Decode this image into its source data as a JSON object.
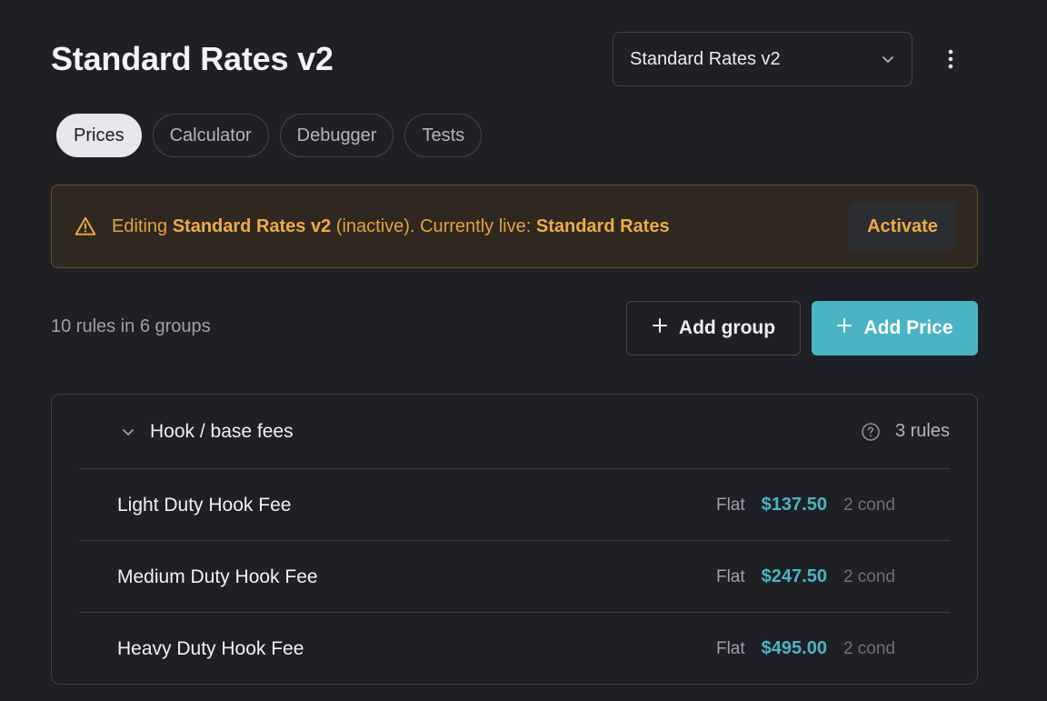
{
  "header": {
    "title": "Standard Rates v2",
    "version_select": {
      "value": "Standard Rates v2",
      "icon": "chevron-down-icon"
    },
    "menu_icon": "kebab-menu-icon"
  },
  "tabs": [
    {
      "label": "Prices",
      "active": true
    },
    {
      "label": "Calculator",
      "active": false
    },
    {
      "label": "Debugger",
      "active": false
    },
    {
      "label": "Tests",
      "active": false
    }
  ],
  "banner": {
    "icon": "warning-icon",
    "prefix": "Editing ",
    "editing_name": "Standard Rates v2",
    "middle": " (inactive). Currently live: ",
    "live_name": "Standard Rates",
    "action_label": "Activate",
    "accent_color": "#eeab44"
  },
  "toolbar": {
    "summary": "10 rules in 6 groups",
    "add_group_label": "Add group",
    "add_price_label": "Add Price",
    "primary_color": "#4ab4c4"
  },
  "groups": [
    {
      "name": "Hook / base fees",
      "count": "3 rules",
      "expanded": true,
      "rules": [
        {
          "name": "Light Duty Hook Fee",
          "type": "Flat",
          "price": "$137.50",
          "conditions": "2 cond"
        },
        {
          "name": "Medium Duty Hook Fee",
          "type": "Flat",
          "price": "$247.50",
          "conditions": "2 cond"
        },
        {
          "name": "Heavy Duty Hook Fee",
          "type": "Flat",
          "price": "$495.00",
          "conditions": "2 cond"
        }
      ]
    }
  ]
}
